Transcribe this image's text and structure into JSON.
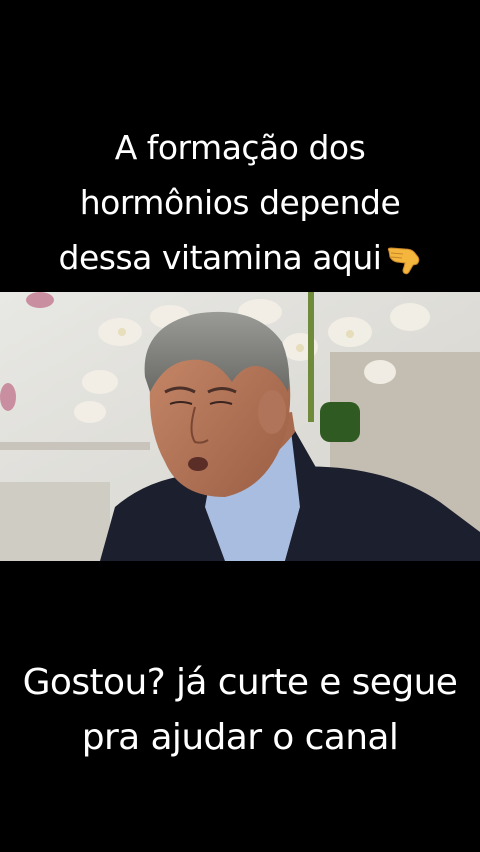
{
  "top_caption": {
    "line1": "A formação dos",
    "line2": "hormônios depende",
    "line3": "dessa vitamina aqui"
  },
  "bottom_caption": {
    "line1": "Gostou? já curte e segue",
    "line2": "pra ajudar o canal"
  },
  "icons": {
    "pointing_down": "pointing-down-hand-emoji"
  }
}
